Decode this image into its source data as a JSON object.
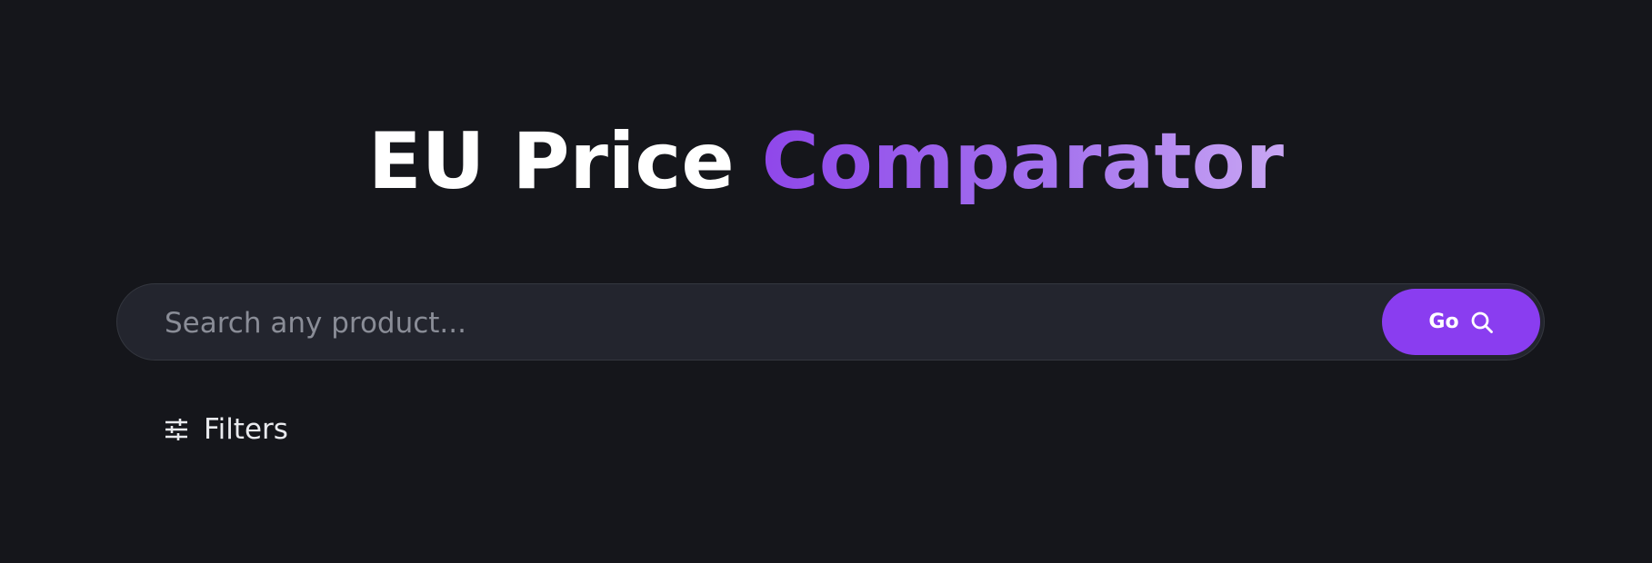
{
  "header": {
    "title_part1": "EU Price",
    "title_part2": "Comparator"
  },
  "search": {
    "placeholder": "Search any product...",
    "value": "",
    "button_label": "Go",
    "button_icon": "search-icon"
  },
  "filters": {
    "label": "Filters",
    "icon": "sliders-icon"
  },
  "colors": {
    "background": "#15161b",
    "accent": "#8a3df0",
    "accent_light": "#c8a6f3",
    "search_bar": "#23252e"
  }
}
